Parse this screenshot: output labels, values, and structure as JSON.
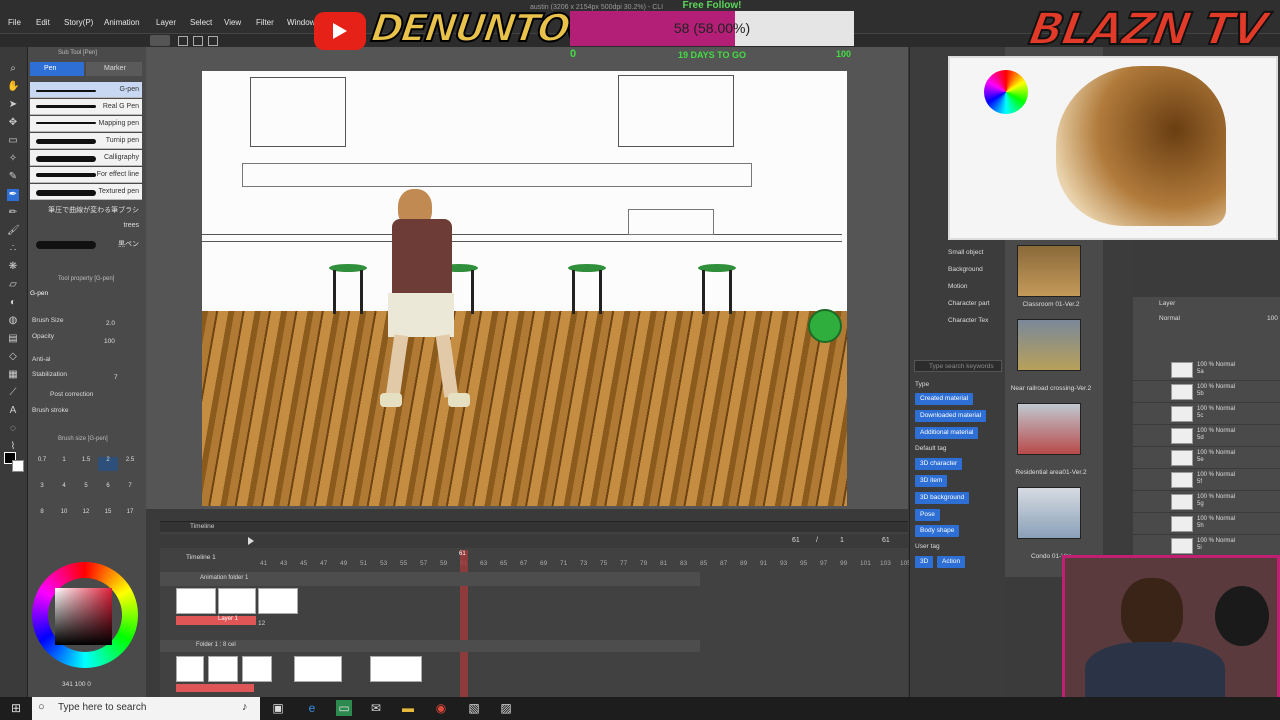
{
  "menu": {
    "items": [
      "File",
      "Edit",
      "Story(P)",
      "Animation",
      "Layer",
      "Select",
      "View",
      "Filter",
      "Window"
    ],
    "canvas_title": "austin (3206 x 2154px 500dpi 30.2%) - CLI"
  },
  "subtool": {
    "title": "Sub Tool [Pen]",
    "tabs": [
      "Pen",
      "Marker"
    ],
    "pens": [
      "G-pen",
      "Real G Pen",
      "Mapping pen",
      "Turnip pen",
      "Calligraphy",
      "For effect line",
      "Textured pen",
      "筆圧で曲線が変わる筆ブラシ",
      "trees",
      "黒ペン"
    ]
  },
  "tool_property": {
    "title": "Tool property [G-pen]",
    "name": "G-pen",
    "brush_size_label": "Brush Size",
    "brush_size_value": "2.0",
    "opacity_label": "Opacity",
    "opacity_value": "100",
    "antialiasing_label": "Anti-al",
    "stabilization_label": "Stabilization",
    "stabilization_value": "7",
    "post_correction_label": "Post correction",
    "brush_stroke_label": "Brush stroke"
  },
  "brush_size_panel": {
    "title": "Brush size [G-pen]",
    "sizes": [
      "0.7",
      "1",
      "1.5",
      "2",
      "2.5",
      "3",
      "4",
      "5",
      "6",
      "7",
      "8",
      "10",
      "12",
      "15",
      "17"
    ]
  },
  "color": {
    "main": "#000000",
    "sub": "#ffffff",
    "coords": "341 100 0"
  },
  "timeline": {
    "title": "Timeline",
    "name": "Timeline 1",
    "frames": [
      "41",
      "43",
      "45",
      "47",
      "49",
      "51",
      "53",
      "55",
      "57",
      "59",
      "61",
      "63",
      "65",
      "67",
      "69",
      "71",
      "73",
      "75",
      "77",
      "79",
      "81",
      "83",
      "85",
      "87",
      "89",
      "91",
      "93",
      "95",
      "97",
      "99",
      "101",
      "103",
      "105"
    ],
    "current_frame": "61",
    "current_of": "61",
    "slash": "/",
    "step": "1",
    "total": "61",
    "track1": "Animation folder 1",
    "track1_layer": "Layer 1",
    "track1_count": "12",
    "track2": "Folder 1 : 8 cel"
  },
  "materials": {
    "tree": [
      "Small object",
      "Background",
      "Motion",
      "Character part",
      "Character Tex"
    ],
    "search_placeholder": "Type search keywords",
    "type_label": "Type",
    "type_tags": [
      "Created material",
      "Downloaded material",
      "Additional material"
    ],
    "default_label": "Default tag",
    "default_tags": [
      "3D character",
      "3D item",
      "3D background",
      "Pose",
      "Body shape"
    ],
    "user_label": "User tag",
    "user_tags": [
      "3D",
      "Action"
    ],
    "items": [
      "Classroom 01-Ver.2",
      "Near railroad crossing-Ver.2",
      "Residential area01-Ver.2",
      "Condo 01-Ver"
    ]
  },
  "layers": {
    "title": "Layer",
    "mode": "Normal",
    "opacity": "100",
    "rows": [
      {
        "a": "100 % Normal",
        "b": "5a"
      },
      {
        "a": "100 % Normal",
        "b": "5b"
      },
      {
        "a": "100 % Normal",
        "b": "5c"
      },
      {
        "a": "100 % Normal",
        "b": "5d"
      },
      {
        "a": "100 % Normal",
        "b": "5e"
      },
      {
        "a": "100 % Normal",
        "b": "5f"
      },
      {
        "a": "100 % Normal",
        "b": "5g"
      },
      {
        "a": "100 % Normal",
        "b": "5h"
      },
      {
        "a": "100 % Normal",
        "b": "5i"
      }
    ]
  },
  "overlay": {
    "channel": "DENUNTOON",
    "goal_title": "Free Follow!",
    "goal_text": "58 (58.00%)",
    "goal_percent": 58,
    "goal_min": "0",
    "goal_days": "19 DAYS TO GO",
    "goal_max": "100",
    "brand": "BLAZN TV"
  },
  "taskbar": {
    "search_placeholder": "Type here to search"
  },
  "colors": {
    "accent": "#b31f76",
    "selection": "#2e6fd6",
    "frame_marker": "#e05555"
  }
}
